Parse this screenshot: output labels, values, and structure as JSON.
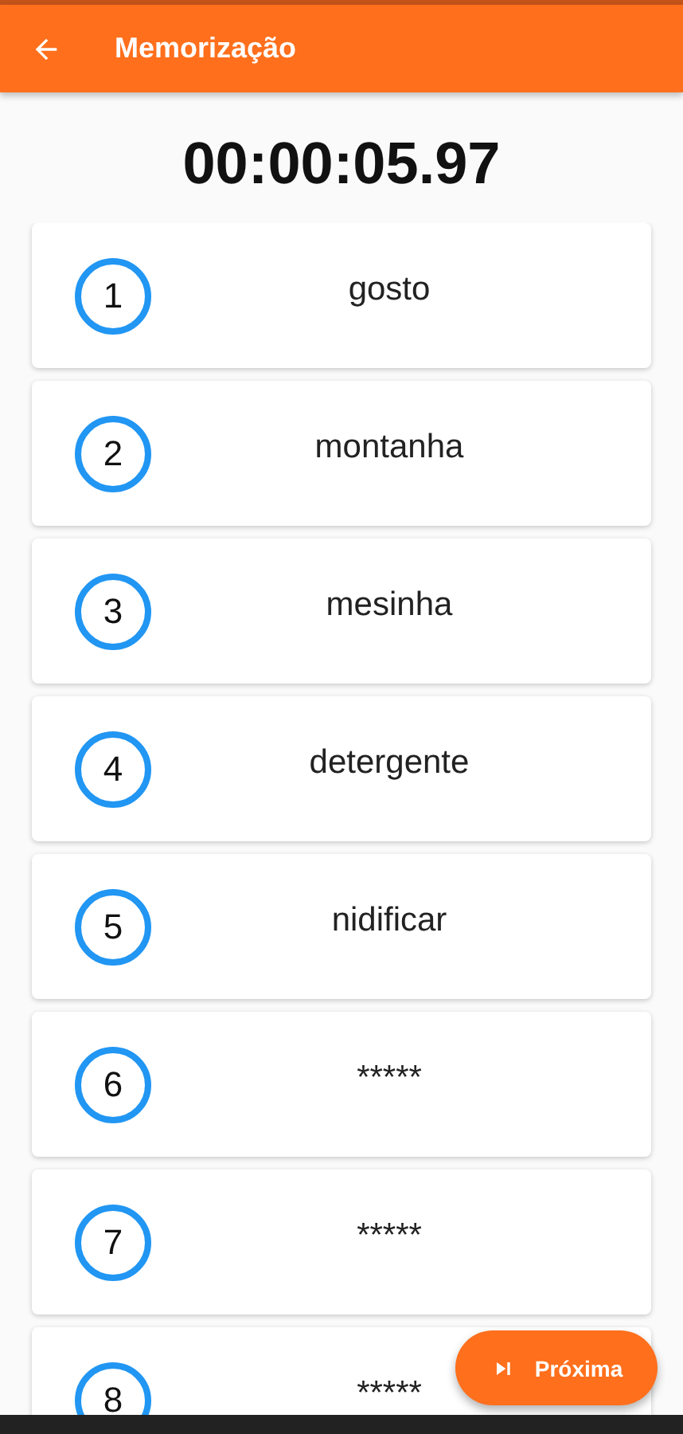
{
  "app_bar": {
    "title": "Memorização"
  },
  "timer": "00:00:05.97",
  "items": [
    {
      "number": "1",
      "word": "gosto"
    },
    {
      "number": "2",
      "word": "montanha"
    },
    {
      "number": "3",
      "word": "mesinha"
    },
    {
      "number": "4",
      "word": "detergente"
    },
    {
      "number": "5",
      "word": "nidificar"
    },
    {
      "number": "6",
      "word": "*****"
    },
    {
      "number": "7",
      "word": "*****"
    },
    {
      "number": "8",
      "word": "*****"
    }
  ],
  "next_button": {
    "label": "Próxima"
  }
}
